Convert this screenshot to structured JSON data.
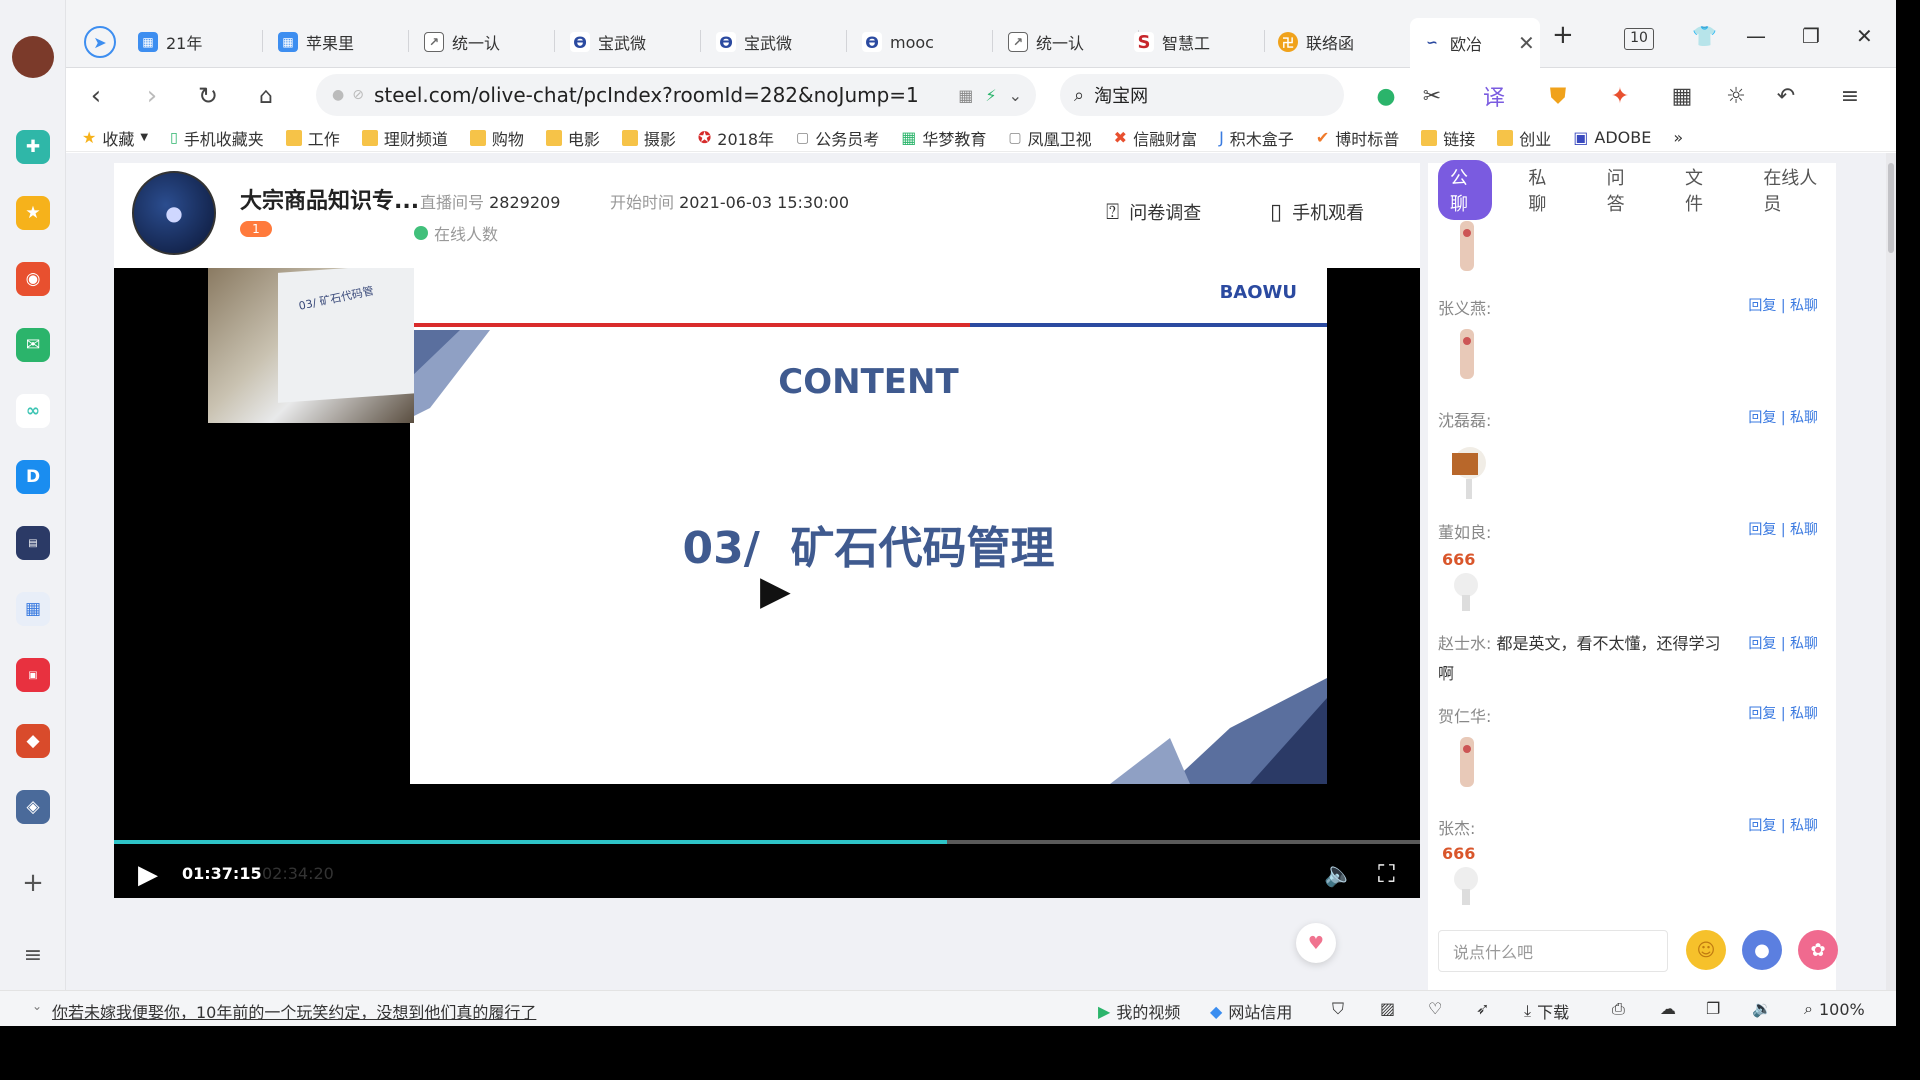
{
  "apps": [
    {
      "name": "profile-avatar",
      "color": "#7b3a2a"
    },
    {
      "name": "app-green",
      "color": "#2fb7a8"
    },
    {
      "name": "app-favorites",
      "color": "#f6b21b"
    },
    {
      "name": "app-weibo",
      "color": "#e8502f"
    },
    {
      "name": "app-mail",
      "color": "#2bb46b"
    },
    {
      "name": "app-cloud",
      "color": "#3cc4b3"
    },
    {
      "name": "app-ding",
      "color": "#1a8df0"
    },
    {
      "name": "app-news",
      "color": "#2b3a66"
    },
    {
      "name": "app-doc",
      "color": "#3a7be0"
    },
    {
      "name": "app-red",
      "color": "#e8313f"
    },
    {
      "name": "app-game1",
      "color": "#d94b2b"
    },
    {
      "name": "app-game2",
      "color": "#4a6a9a"
    }
  ],
  "tabs": [
    {
      "label": "21年",
      "color": "#3d8ef0"
    },
    {
      "label": "苹果里",
      "color": "#3d8ef0"
    },
    {
      "label": "统一认",
      "color": "#555"
    },
    {
      "label": "宝武微",
      "color": "#2b4aa0"
    },
    {
      "label": "宝武微",
      "color": "#2b4aa0"
    },
    {
      "label": "mooc",
      "color": "#2b4aa0"
    },
    {
      "label": "统一认",
      "color": "#555"
    },
    {
      "label": "智慧工",
      "color": "#c7262b"
    },
    {
      "label": "联络函",
      "color": "#f0a21b"
    },
    {
      "label": "欧冶",
      "color": "#2b4aa0"
    }
  ],
  "tab_count": "10",
  "address": "steel.com/olive-chat/pcIndex?roomId=282&noJump=1",
  "search_text": "淘宝网",
  "bookmarks": [
    {
      "label": "收藏",
      "icon": "star"
    },
    {
      "label": "手机收藏夹",
      "icon": "phone"
    },
    {
      "label": "工作",
      "icon": "folder"
    },
    {
      "label": "理财频道",
      "icon": "folder"
    },
    {
      "label": "购物",
      "icon": "folder"
    },
    {
      "label": "电影",
      "icon": "folder"
    },
    {
      "label": "摄影",
      "icon": "folder"
    },
    {
      "label": "2018年",
      "icon": "logo"
    },
    {
      "label": "公务员考",
      "icon": "doc"
    },
    {
      "label": "华梦教育",
      "icon": "logo"
    },
    {
      "label": "凤凰卫视",
      "icon": "doc"
    },
    {
      "label": "信融财富",
      "icon": "logo"
    },
    {
      "label": "积木盒子",
      "icon": "logo"
    },
    {
      "label": "博时标普",
      "icon": "logo"
    },
    {
      "label": "链接",
      "icon": "folder"
    },
    {
      "label": "创业",
      "icon": "folder"
    },
    {
      "label": "ADOBE",
      "icon": "logo"
    }
  ],
  "live": {
    "title": "大宗商品知识专...",
    "badge": "1",
    "room_label": "直播间号",
    "room_id": "2829209",
    "start_label": "开始时间",
    "start_time": "2021-06-03 15:30:00",
    "online_label": "在线人数",
    "survey_label": "问卷调查",
    "mobile_label": "手机观看"
  },
  "slide": {
    "brand": "BAOWU",
    "heading": "CONTENT",
    "section": "03/  矿石代码管理",
    "cam_text": "03/ 矿石代码管"
  },
  "player": {
    "current_time": "01:37:15",
    "total_time": "02:34:20",
    "progress": 0.638
  },
  "chat": {
    "tabs": [
      "公聊",
      "私聊",
      "问答",
      "文件",
      "在线人员"
    ],
    "active_tab": "公聊",
    "reply_label": "回复",
    "private_label": "私聊",
    "messages": [
      {
        "name": "张义燕:",
        "text": ""
      },
      {
        "name": "沈磊磊:",
        "text": ""
      },
      {
        "name": "董如良:",
        "text": ""
      },
      {
        "name": "赵士水:",
        "text": "都是英文，看不太懂，还得学习啊"
      },
      {
        "name": "贺仁华:",
        "text": ""
      },
      {
        "name": "张杰:",
        "text": ""
      }
    ],
    "input_placeholder": "说点什么吧"
  },
  "status": {
    "news": "你若未嫁我便娶你，10年前的一个玩笑约定，没想到他们真的履行了",
    "my_video": "我的视频",
    "site_credit": "网站信用",
    "download": "下载",
    "zoom": "100%"
  }
}
